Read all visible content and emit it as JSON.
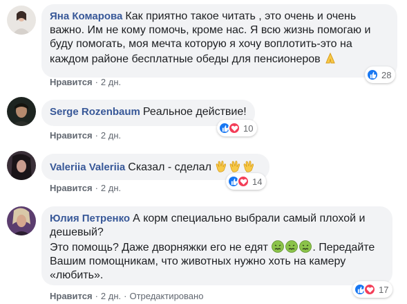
{
  "comments": [
    {
      "author": "Яна Комарова",
      "text": "Как приятно такое читать , это очень и очень важно. Им не кому помочь, кроме нас. Я всю жизнь помогаю и буду помогать, моя мечта которую я хочу воплотить-это на каждом районе бесплатные обеды для пенсионеров",
      "like_label": "Нравится",
      "time": "2 дн.",
      "reaction_count": "28"
    },
    {
      "author": "Serge Rozenbaum",
      "text": "Реальное действие!",
      "like_label": "Нравится",
      "time": "2 дн.",
      "reaction_count": "10"
    },
    {
      "author": "Valeriia Valeriia",
      "text": "Сказал - сделал",
      "like_label": "Нравится",
      "time": "2 дн.",
      "reaction_count": "14"
    },
    {
      "author": "Юлия Петренко",
      "text_line1": "А корм специально выбрали самый плохой и дешевый?",
      "text_line2": "Это помощь? Даже дворняжки его не едят",
      "text_line3": ". Передайте Вашим помощникам, что животных нужно хоть на камеру «любить».",
      "like_label": "Нравится",
      "time": "2 дн.",
      "edited": "Отредактировано",
      "reaction_count": "17"
    }
  ],
  "colors": {
    "author": "#385898",
    "bubble": "#f2f3f5",
    "like_blue": "#1877f2",
    "love_red": "#f33e58"
  },
  "icons": [
    "like-icon",
    "love-icon",
    "pray-emoji",
    "clap-emoji",
    "nauseated-emoji"
  ]
}
